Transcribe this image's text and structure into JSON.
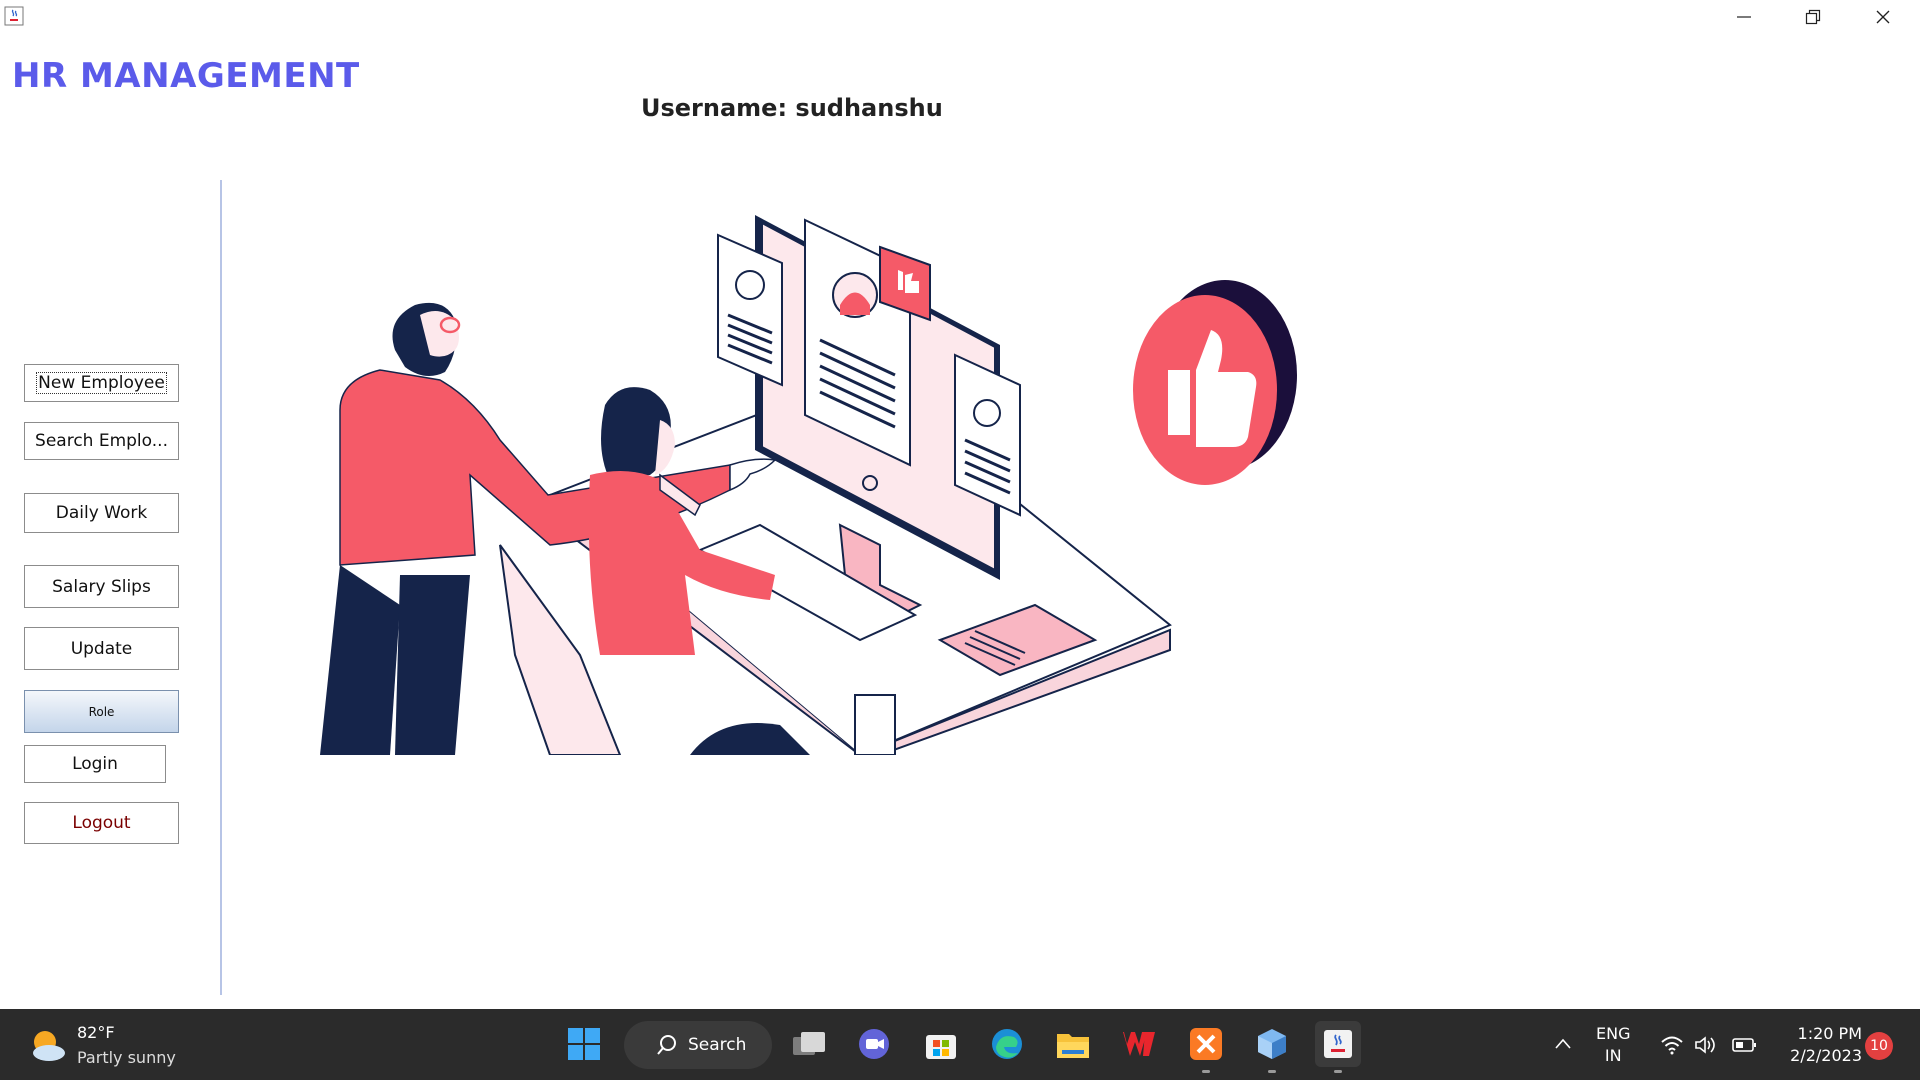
{
  "app": {
    "title": "HR MANAGEMENT",
    "username_label": "Username: sudhanshu"
  },
  "window_controls": {
    "minimize": "minimize-icon",
    "restore": "restore-icon",
    "close": "close-icon"
  },
  "sidebar": {
    "buttons": [
      {
        "label": "New Employee"
      },
      {
        "label": "Search Emplo..."
      },
      {
        "label": "Daily Work"
      },
      {
        "label": "Salary Slips"
      },
      {
        "label": "Update"
      },
      {
        "label": "Role"
      },
      {
        "label": "Login"
      },
      {
        "label": "Logout"
      }
    ]
  },
  "colors": {
    "title": "#5b5bea",
    "accent": "#f55a68",
    "navy": "#15244a",
    "taskbar": "#2b2b2b"
  },
  "taskbar": {
    "weather": {
      "temp": "82°F",
      "desc": "Partly sunny",
      "icon": "partly-sunny-icon"
    },
    "search_label": "Search",
    "apps": [
      "windows-start-icon",
      "task-view-icon",
      "teams-chat-icon",
      "microsoft-store-icon",
      "edge-browser-icon",
      "file-explorer-icon",
      "wps-office-icon",
      "xampp-icon",
      "virtualbox-icon",
      "java-app-icon"
    ],
    "tray": {
      "lang_top": "ENG",
      "lang_bottom": "IN",
      "time": "1:20 PM",
      "date": "2/2/2023",
      "notification_count": "10"
    }
  }
}
